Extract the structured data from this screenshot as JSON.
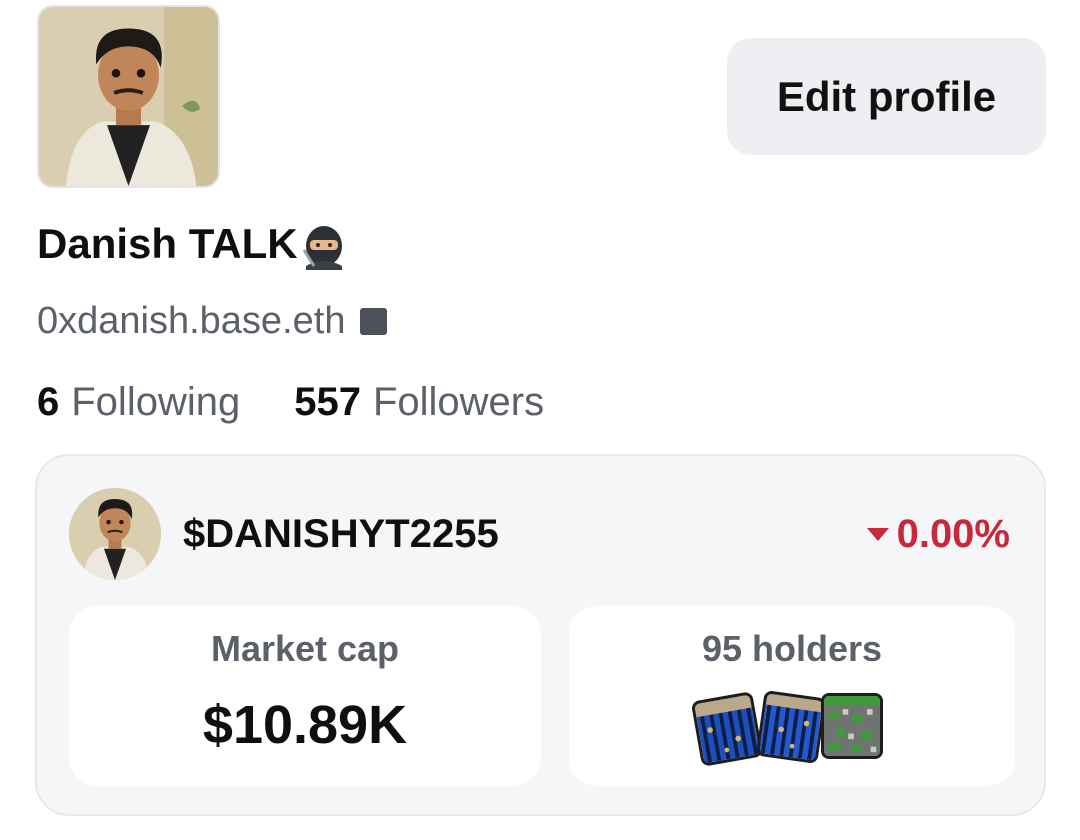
{
  "profile": {
    "display_name": "Danish TALK",
    "name_emoji_icon": "ninja-icon",
    "handle": "0xdanish.base.eth",
    "handle_badge_icon": "square-icon",
    "edit_button_label": "Edit profile"
  },
  "stats": {
    "following_count": "6",
    "following_label": "Following",
    "followers_count": "557",
    "followers_label": "Followers"
  },
  "token": {
    "ticker": "$DANISHYT2255",
    "change": "0.00%",
    "change_direction_icon": "caret-down-icon",
    "market_cap_label": "Market cap",
    "market_cap_value": "$10.89K",
    "holders_label": "95 holders"
  },
  "colors": {
    "negative": "#c8283a",
    "card_bg": "#f5f6f8",
    "button_bg": "#eeeff2",
    "muted_text": "#5b6069"
  }
}
